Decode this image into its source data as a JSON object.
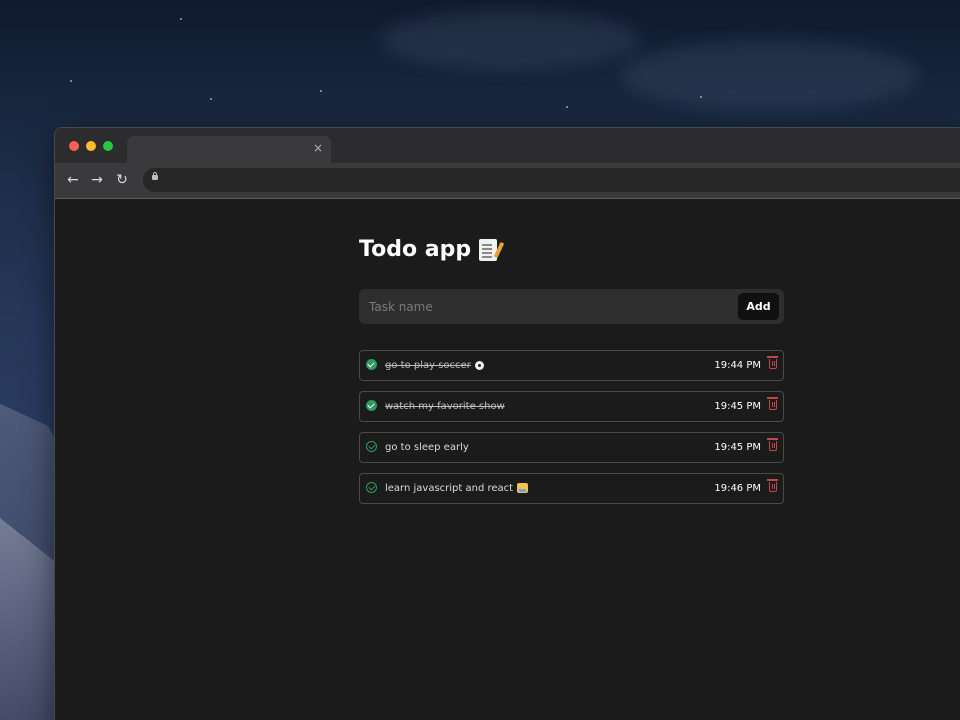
{
  "browser": {
    "tab_close_glyph": "×",
    "nav": {
      "back": "←",
      "forward": "→",
      "reload": "↻"
    }
  },
  "app": {
    "title": "Todo app",
    "title_icon": "memo-icon",
    "input": {
      "placeholder": "Task name",
      "value": ""
    },
    "add_label": "Add",
    "tasks": [
      {
        "name": "go to play soccer",
        "emoji_icon": "soccer-ball-icon",
        "time": "19:44 PM",
        "completed": true
      },
      {
        "name": "watch my favorite show",
        "time": "19:45 PM",
        "completed": true
      },
      {
        "name": "go to sleep early",
        "time": "19:45 PM",
        "completed": false
      },
      {
        "name": "learn javascript and react",
        "emoji_icon": "technologist-icon",
        "time": "19:46 PM",
        "completed": false
      }
    ]
  },
  "colors": {
    "background": "#1b1b1b",
    "check_green": "#2f9a5f",
    "trash_red": "#c24848",
    "input_bg": "#2e2e2e",
    "button_bg": "#101010"
  }
}
